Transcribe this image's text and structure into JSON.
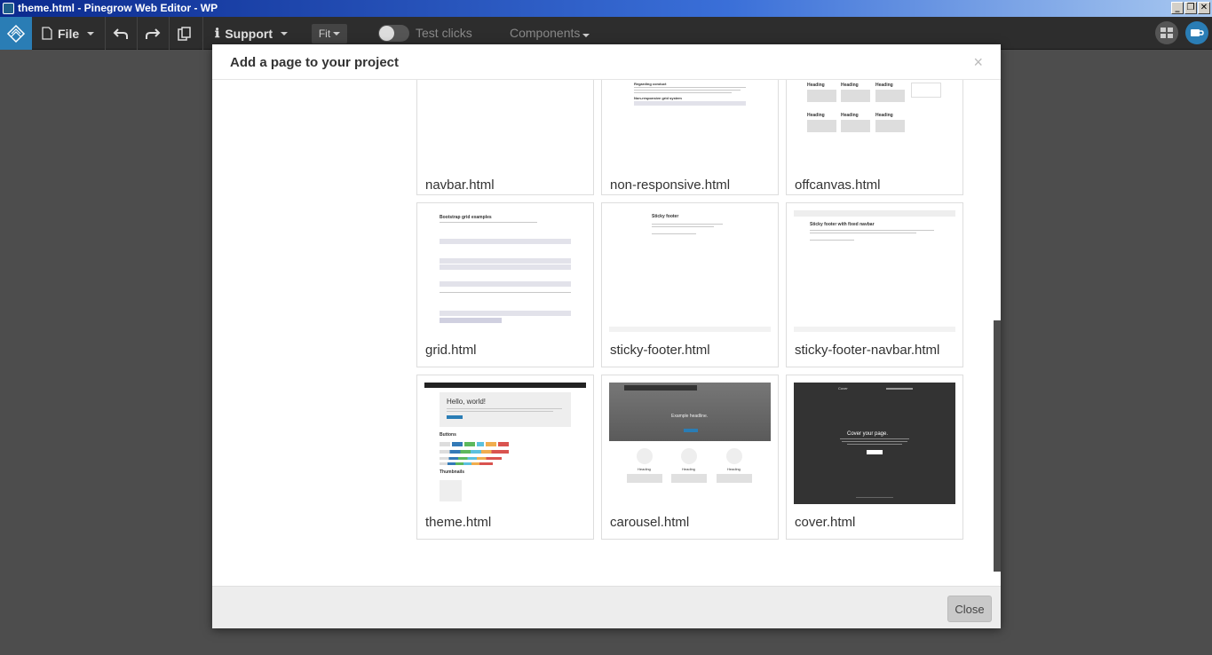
{
  "window": {
    "title": "theme.html - Pinegrow Web Editor - WP"
  },
  "toolbar": {
    "file_label": "File",
    "support_label": "Support",
    "fit_label": "Fit",
    "test_clicks_label": "Test clicks",
    "components_label": "Components"
  },
  "modal": {
    "title": "Add a page to your project",
    "close_x": "×",
    "close_button": "Close",
    "templates": [
      {
        "label": "navbar.html"
      },
      {
        "label": "non-responsive.html"
      },
      {
        "label": "offcanvas.html"
      },
      {
        "label": "grid.html"
      },
      {
        "label": "sticky-footer.html"
      },
      {
        "label": "sticky-footer-navbar.html"
      },
      {
        "label": "theme.html"
      },
      {
        "label": "carousel.html"
      },
      {
        "label": "cover.html"
      }
    ],
    "previews": {
      "regarding": "Regarding conduct",
      "non_resp_grid": "Non-responsive grid system",
      "heading": "Heading",
      "grid_title": "Bootstrap grid examples",
      "sticky_title": "Sticky footer",
      "sticky_nav_title": "Sticky footer with fixed navbar",
      "hello": "Hello, world!",
      "buttons": "Buttons",
      "thumbnails": "Thumbnails",
      "example_headline": "Example headline.",
      "cover_title": "Cover your page.",
      "cover_brand": "Cover"
    }
  },
  "colors": {
    "toolbar_bg": "#2d2d2d",
    "accent": "#2a7db5",
    "backdrop": "#4d4d4d"
  }
}
